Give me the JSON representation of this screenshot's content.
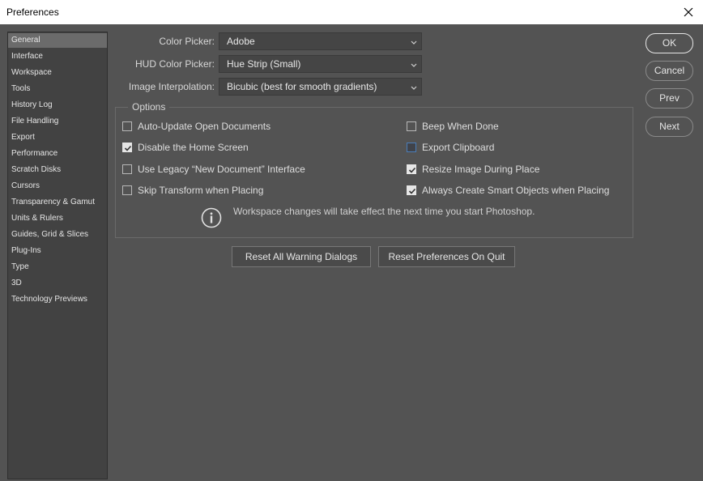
{
  "window": {
    "title": "Preferences",
    "close_icon": "close-icon"
  },
  "sidebar": {
    "items": [
      {
        "label": "General",
        "selected": true
      },
      {
        "label": "Interface"
      },
      {
        "label": "Workspace"
      },
      {
        "label": "Tools"
      },
      {
        "label": "History Log"
      },
      {
        "label": "File Handling"
      },
      {
        "label": "Export"
      },
      {
        "label": "Performance"
      },
      {
        "label": "Scratch Disks"
      },
      {
        "label": "Cursors"
      },
      {
        "label": "Transparency & Gamut"
      },
      {
        "label": "Units & Rulers"
      },
      {
        "label": "Guides, Grid & Slices"
      },
      {
        "label": "Plug-Ins"
      },
      {
        "label": "Type"
      },
      {
        "label": "3D"
      },
      {
        "label": "Technology Previews"
      }
    ]
  },
  "settings": {
    "color_picker": {
      "label": "Color Picker:",
      "value": "Adobe"
    },
    "hud_color_picker": {
      "label": "HUD Color Picker:",
      "value": "Hue Strip (Small)"
    },
    "image_interpolation": {
      "label": "Image Interpolation:",
      "value": "Bicubic (best for smooth gradients)"
    }
  },
  "options": {
    "legend": "Options",
    "left": [
      {
        "label": "Auto-Update Open Documents",
        "checked": false
      },
      {
        "label": "Disable the Home Screen",
        "checked": true
      },
      {
        "label": "Use Legacy “New Document” Interface",
        "checked": false
      },
      {
        "label": "Skip Transform when Placing",
        "checked": false
      }
    ],
    "right": [
      {
        "label": "Beep When Done",
        "checked": false
      },
      {
        "label": "Export Clipboard",
        "checked": false,
        "focused": true
      },
      {
        "label": "Resize Image During Place",
        "checked": true
      },
      {
        "label": "Always Create Smart Objects when Placing",
        "checked": true
      }
    ],
    "info_text": "Workspace changes will take effect the next time you start Photoshop."
  },
  "buttons": {
    "reset_warnings": "Reset All Warning Dialogs",
    "reset_prefs": "Reset Preferences On Quit",
    "ok": "OK",
    "cancel": "Cancel",
    "prev": "Prev",
    "next": "Next"
  }
}
